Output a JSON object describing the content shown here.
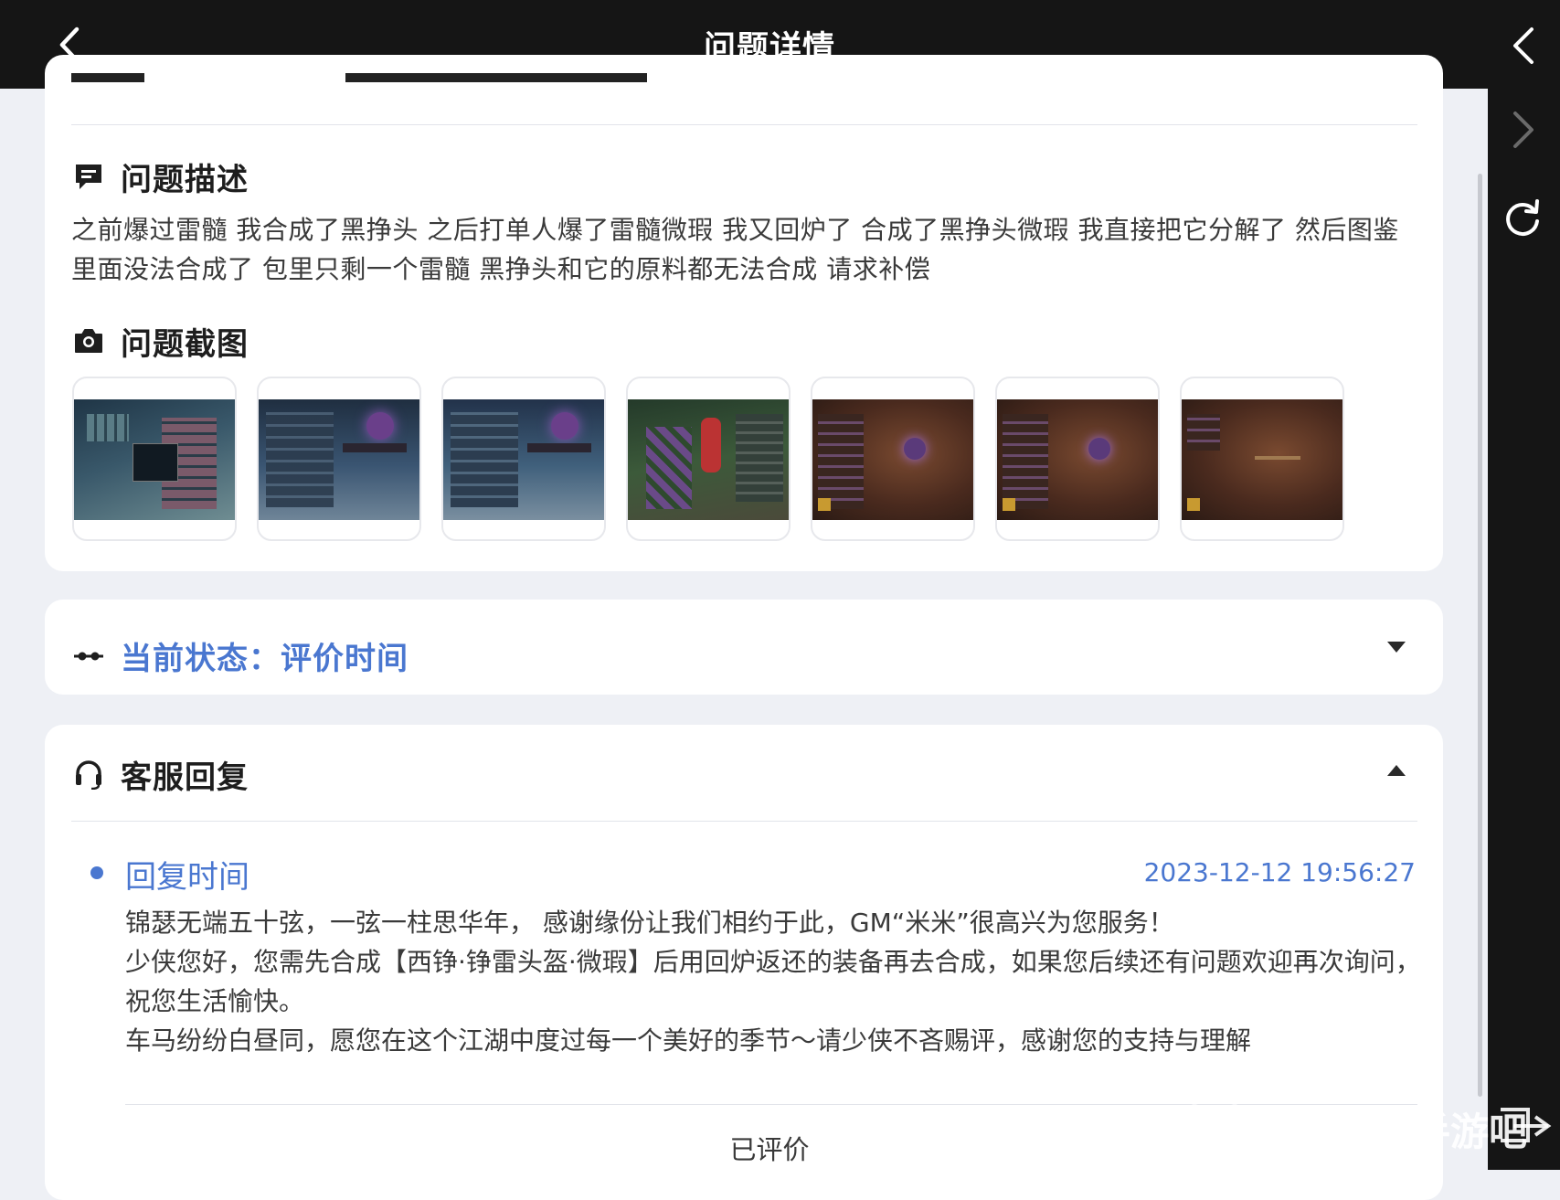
{
  "header": {
    "title": "问题详情"
  },
  "issue": {
    "description": {
      "heading": "问题描述",
      "text": "之前爆过雷髓 我合成了黑挣头 之后打单人爆了雷髓微瑕 我又回炉了 合成了黑挣头微瑕 我直接把它分解了 然后图鉴里面没法合成了 包里只剩一个雷髓 黑挣头和它的原料都无法合成 请求补偿"
    },
    "screenshots": {
      "heading": "问题截图",
      "count": 7
    }
  },
  "status": {
    "label": "当前状态：评价时间"
  },
  "reply": {
    "heading": "客服回复",
    "time_label": "回复时间",
    "time_value": "2023-12-12 19:56:27",
    "lines": [
      "锦瑟无端五十弦，一弦一柱思华年， 感谢缘份让我们相约于此，GM“米米”很高兴为您服务！",
      "少侠您好，您需先合成【西铮·铮雷头盔·微瑕】后用回炉返还的装备再去合成，如果您后续还有问题欢迎再次询问，祝您生活愉快。",
      "车马纷纷白昼同，愿您在这个江湖中度过每一个美好的季节～请少侠不吝赐评，感谢您的支持与理解"
    ],
    "rated_label": "已评价"
  },
  "watermark": {
    "text": "手游吧"
  },
  "colors": {
    "accent": "#4a77d0",
    "topbar": "#151515",
    "background": "#eef0f5"
  },
  "icons": [
    "back-icon",
    "forward-icon",
    "refresh-icon",
    "message-icon",
    "camera-icon",
    "status-flow-icon",
    "headset-icon",
    "caret-down-icon",
    "caret-up-icon"
  ]
}
